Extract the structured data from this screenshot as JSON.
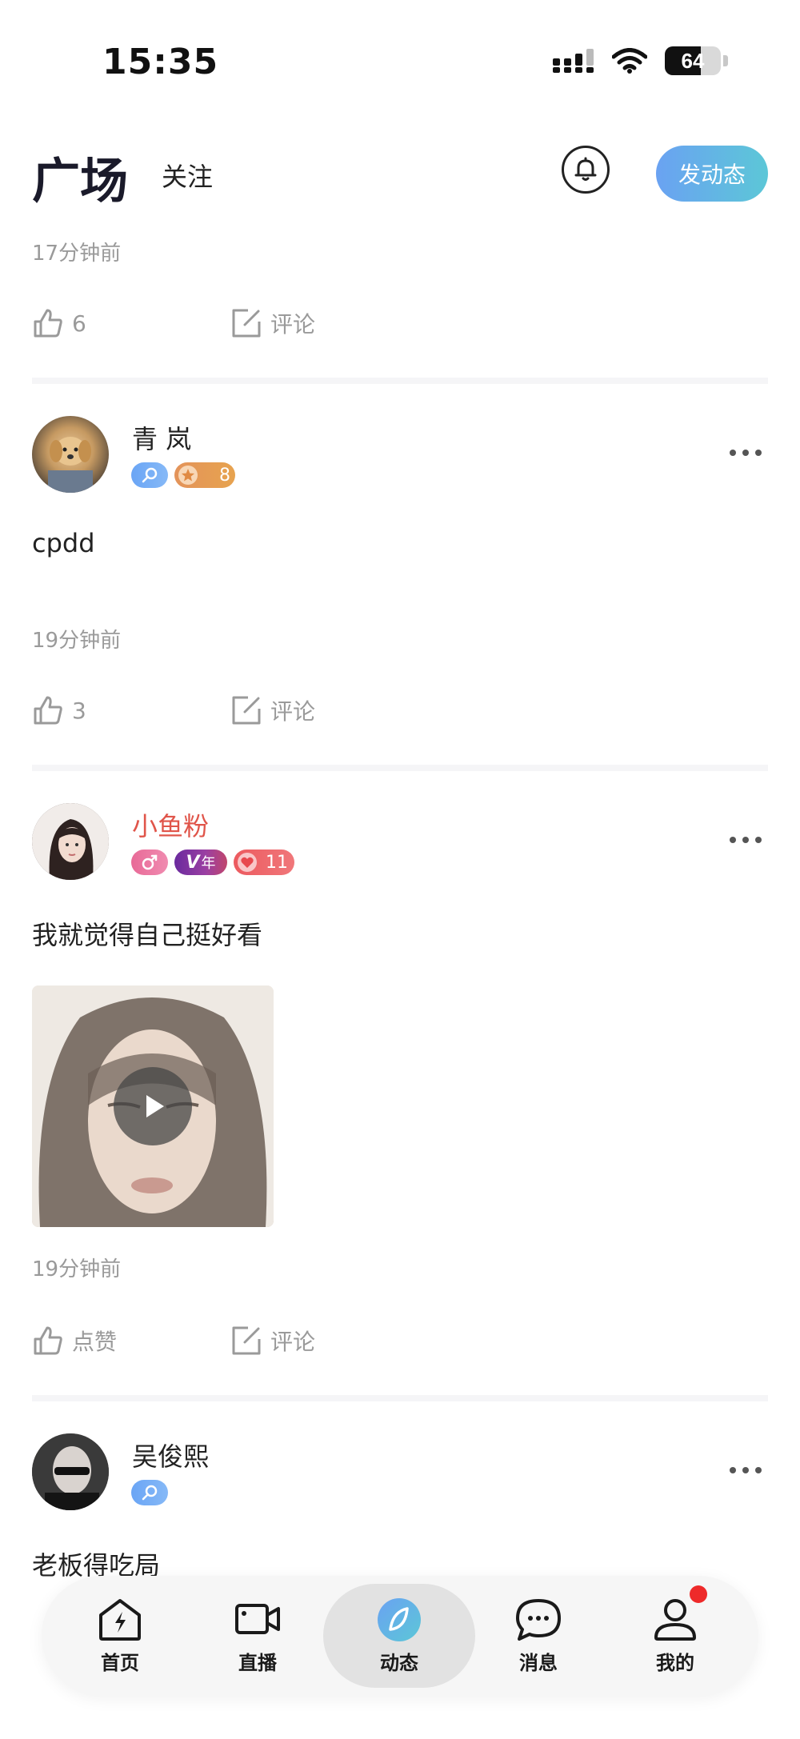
{
  "status_bar": {
    "time": "15:35",
    "battery_level": "64",
    "battery_fraction": 0.64
  },
  "header": {
    "tab_square": "广场",
    "tab_follow": "关注",
    "post_button": "发动态"
  },
  "feed": {
    "prev_post": {
      "time": "17分钟前",
      "likes": "6",
      "comment_label": "评论"
    },
    "posts": [
      {
        "username": "青 岚",
        "badge_level": "8",
        "content": "cpdd",
        "time": "19分钟前",
        "likes": "3",
        "comment_label": "评论"
      },
      {
        "username": "小鱼粉",
        "badge_vip": "年",
        "badge_level": "11",
        "content": "我就觉得自己挺好看",
        "time": "19分钟前",
        "likes": "点赞",
        "comment_label": "评论"
      },
      {
        "username": "吴俊熙",
        "content": "老板得吃局"
      }
    ]
  },
  "bottom_nav": {
    "items": [
      {
        "label": "首页",
        "icon": "home-bolt-icon"
      },
      {
        "label": "直播",
        "icon": "video-camera-icon"
      },
      {
        "label": "动态",
        "icon": "compass-leaf-icon"
      },
      {
        "label": "消息",
        "icon": "chat-bubble-icon"
      },
      {
        "label": "我的",
        "icon": "user-icon"
      }
    ]
  },
  "colors": {
    "accent_gradient_start": "#6aa2f2",
    "accent_gradient_end": "#5cc7d7",
    "vip_name": "#e0554a",
    "notification_dot": "#ee2a2a"
  }
}
